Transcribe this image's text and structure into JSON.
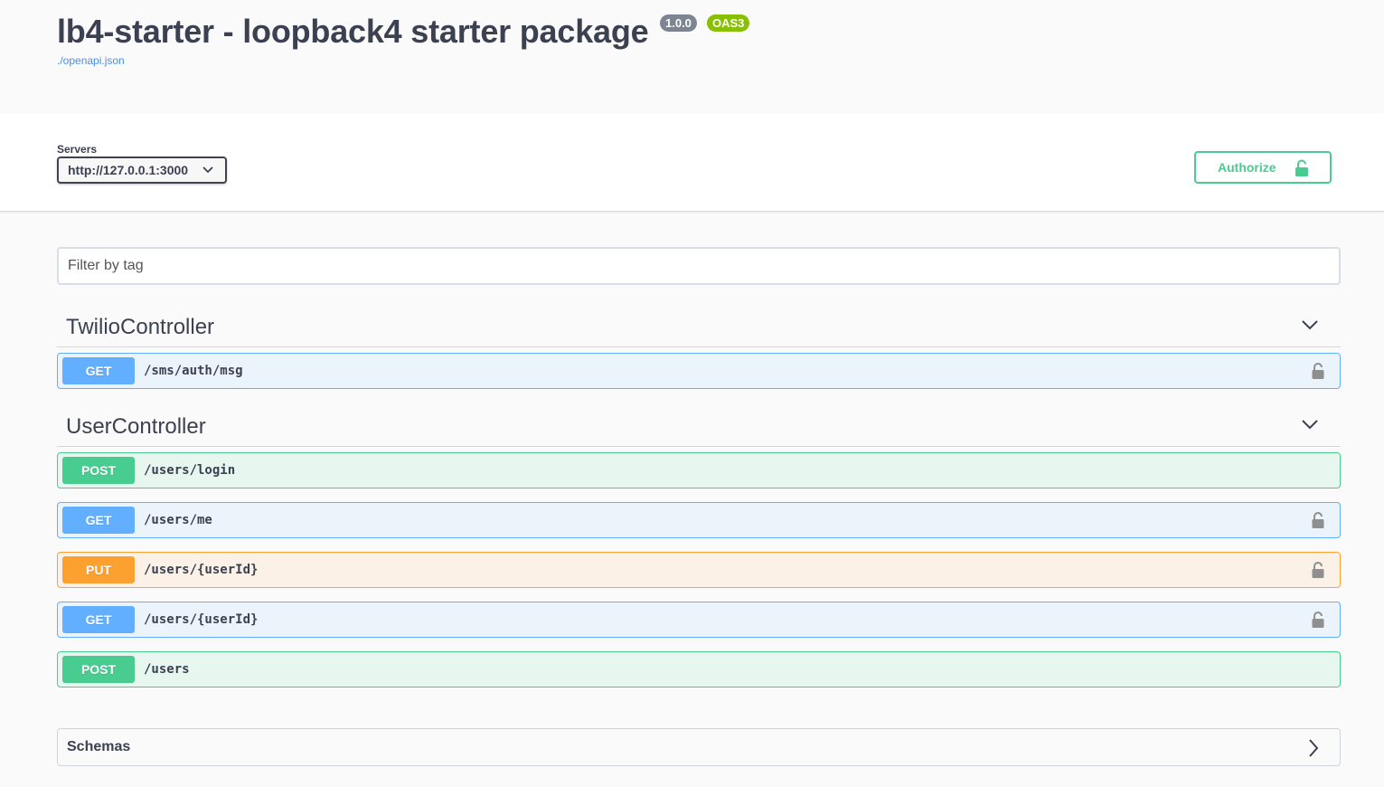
{
  "info": {
    "title": "lb4-starter - loopback4 starter package",
    "version": "1.0.0",
    "oas_badge": "OAS3",
    "spec_link": "./openapi.json"
  },
  "servers": {
    "label": "Servers",
    "selected": "http://127.0.0.1:3000"
  },
  "authorize": {
    "label": "Authorize"
  },
  "filter": {
    "placeholder": "Filter by tag"
  },
  "tags": [
    {
      "name": "TwilioController",
      "operations": [
        {
          "method": "GET",
          "path": "/sms/auth/msg",
          "locked": true
        }
      ]
    },
    {
      "name": "UserController",
      "operations": [
        {
          "method": "POST",
          "path": "/users/login",
          "locked": false
        },
        {
          "method": "GET",
          "path": "/users/me",
          "locked": true
        },
        {
          "method": "PUT",
          "path": "/users/{userId}",
          "locked": true
        },
        {
          "method": "GET",
          "path": "/users/{userId}",
          "locked": true
        },
        {
          "method": "POST",
          "path": "/users",
          "locked": false
        }
      ]
    }
  ],
  "schemas": {
    "label": "Schemas"
  },
  "colors": {
    "get": "#61affe",
    "post": "#49cc90",
    "put": "#fca130",
    "authorize": "#49cc90"
  }
}
